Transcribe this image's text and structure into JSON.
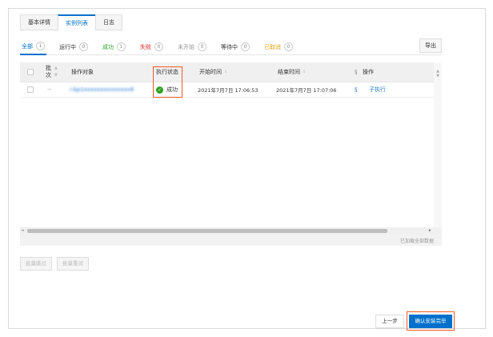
{
  "tabs": [
    {
      "label": "基本详情"
    },
    {
      "label": "实例列表",
      "active": true
    },
    {
      "label": "日志"
    }
  ],
  "filters": [
    {
      "label": "全部",
      "count": "1",
      "color": "#0070cc"
    },
    {
      "label": "运行中",
      "count": "0",
      "color": "#333333"
    },
    {
      "label": "成功",
      "count": "1",
      "color": "#2ea121"
    },
    {
      "label": "失败",
      "count": "0",
      "color": "#e62222"
    },
    {
      "label": "未开始",
      "count": "0",
      "color": "#999999"
    },
    {
      "label": "等待中",
      "count": "0",
      "color": "#333333"
    },
    {
      "label": "已取消",
      "count": "0",
      "color": "#e6a117"
    }
  ],
  "export_label": "导出",
  "table": {
    "headers": {
      "batch": "批次",
      "target": "操作对象",
      "status": "执行状态",
      "start": "开始时间",
      "end": "结束时间",
      "more": "§",
      "action": "操作"
    },
    "rows": [
      {
        "batch": "--",
        "target": "i-bp1xxxxxxxxxxxxxx8",
        "status": "成功",
        "start": "2021年7月7日 17:06:53",
        "end": "2021年7月7日 17:07:06",
        "more": "§",
        "action": "子执行"
      }
    ],
    "loaded_text": "已加载全部数据"
  },
  "batch_skip": "批量跳过",
  "batch_retry": "批量重试",
  "prev_label": "上一步",
  "confirm_label": "确认安装完毕",
  "colors": {
    "accent": "#0070cc",
    "success": "#2ea121",
    "highlight": "#f05a28"
  }
}
